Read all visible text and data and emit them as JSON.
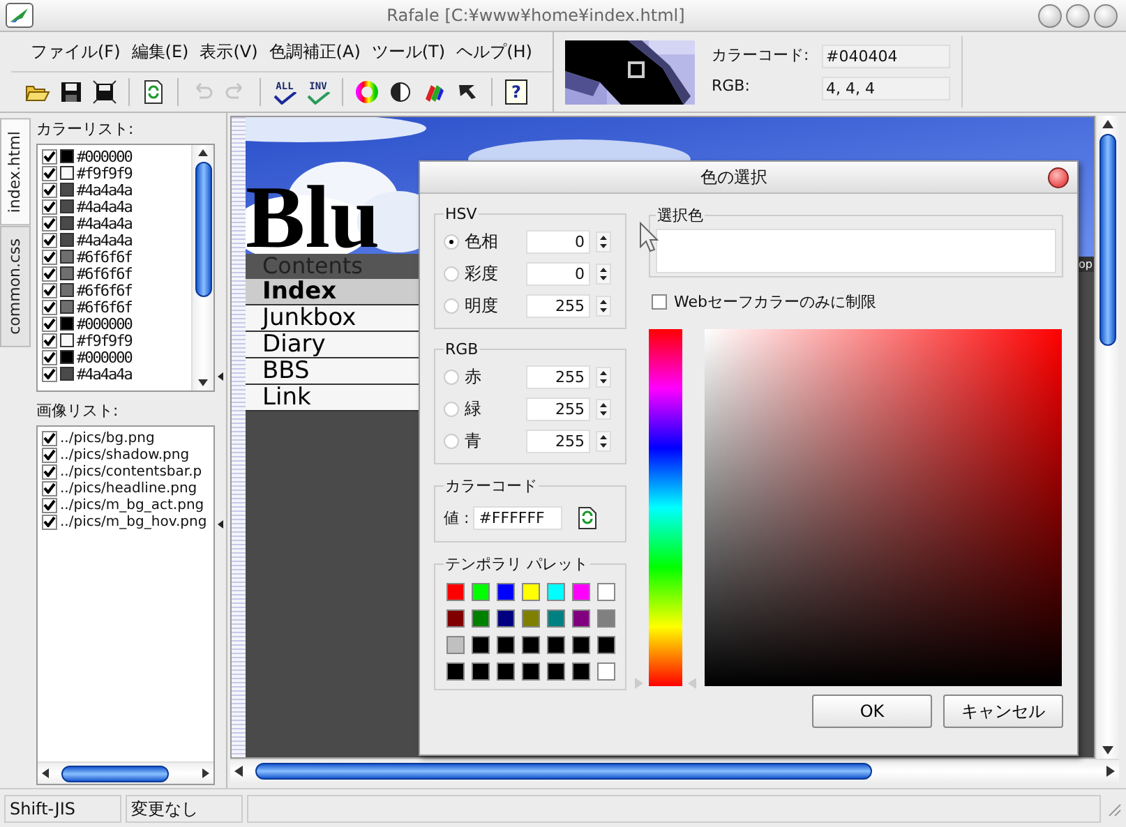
{
  "window": {
    "title": "Rafale [C:¥www¥home¥index.html]"
  },
  "menu": [
    "ファイル(F)",
    "編集(E)",
    "表示(V)",
    "色調補正(A)",
    "ツール(T)",
    "ヘルプ(H)"
  ],
  "toolbar": [
    [
      {
        "kind": "open",
        "disabled": false
      },
      {
        "kind": "save",
        "disabled": false
      },
      {
        "kind": "save-all",
        "disabled": false
      }
    ],
    [
      {
        "kind": "reload",
        "disabled": false
      }
    ],
    [
      {
        "kind": "undo",
        "disabled": true
      },
      {
        "kind": "redo",
        "disabled": true
      }
    ],
    [
      {
        "kind": "check-all",
        "disabled": false,
        "caption": "ALL"
      },
      {
        "kind": "check-invert",
        "disabled": false,
        "caption": "INV"
      }
    ],
    [
      {
        "kind": "color-wheel",
        "disabled": false
      },
      {
        "kind": "contrast",
        "disabled": false
      },
      {
        "kind": "rgb",
        "disabled": false
      },
      {
        "kind": "pointer",
        "disabled": false
      }
    ],
    [
      {
        "kind": "help",
        "disabled": false,
        "caption": "?"
      }
    ]
  ],
  "pixel_info": {
    "code_label": "カラーコード:",
    "code": "#040404",
    "rgb_label": "RGB:",
    "rgb": "4, 4, 4"
  },
  "file_tabs": [
    {
      "label": "index.html",
      "selected": true
    },
    {
      "label": "common.css",
      "selected": false
    }
  ],
  "color_list": {
    "title": "カラーリスト:",
    "items": [
      {
        "checked": true,
        "color": "#000000",
        "code": "#000000"
      },
      {
        "checked": true,
        "color": "#f9f9f9",
        "code": "#f9f9f9"
      },
      {
        "checked": true,
        "color": "#4a4a4a",
        "code": "#4a4a4a"
      },
      {
        "checked": true,
        "color": "#4a4a4a",
        "code": "#4a4a4a"
      },
      {
        "checked": true,
        "color": "#4a4a4a",
        "code": "#4a4a4a"
      },
      {
        "checked": true,
        "color": "#4a4a4a",
        "code": "#4a4a4a"
      },
      {
        "checked": true,
        "color": "#6f6f6f",
        "code": "#6f6f6f"
      },
      {
        "checked": true,
        "color": "#6f6f6f",
        "code": "#6f6f6f"
      },
      {
        "checked": true,
        "color": "#6f6f6f",
        "code": "#6f6f6f"
      },
      {
        "checked": true,
        "color": "#6f6f6f",
        "code": "#6f6f6f"
      },
      {
        "checked": true,
        "color": "#000000",
        "code": "#000000"
      },
      {
        "checked": true,
        "color": "#f9f9f9",
        "code": "#f9f9f9"
      },
      {
        "checked": true,
        "color": "#000000",
        "code": "#000000"
      },
      {
        "checked": true,
        "color": "#4a4a4a",
        "code": "#4a4a4a"
      }
    ]
  },
  "image_list": {
    "title": "画像リスト:",
    "items": [
      {
        "checked": true,
        "path": "../pics/bg.png"
      },
      {
        "checked": true,
        "path": "../pics/shadow.png"
      },
      {
        "checked": true,
        "path": "../pics/contentsbar.p"
      },
      {
        "checked": true,
        "path": "../pics/headline.png"
      },
      {
        "checked": true,
        "path": "../pics/m_bg_act.png"
      },
      {
        "checked": true,
        "path": "../pics/m_bg_hov.png"
      }
    ]
  },
  "preview": {
    "heading": "Blu",
    "menu_title": "Contents",
    "menu": [
      {
        "label": "Index",
        "selected": true
      },
      {
        "label": "Junkbox",
        "selected": false
      },
      {
        "label": "Diary",
        "selected": false
      },
      {
        "label": "BBS",
        "selected": false
      },
      {
        "label": "Link",
        "selected": false
      }
    ],
    "tag": "op"
  },
  "dialog": {
    "title": "色の選択",
    "hsv": {
      "title": "HSV",
      "rows": [
        {
          "label": "色相",
          "value": "0",
          "selected": true
        },
        {
          "label": "彩度",
          "value": "0",
          "selected": false
        },
        {
          "label": "明度",
          "value": "255",
          "selected": false
        }
      ]
    },
    "rgb": {
      "title": "RGB",
      "rows": [
        {
          "label": "赤",
          "value": "255",
          "selected": false
        },
        {
          "label": "緑",
          "value": "255",
          "selected": false
        },
        {
          "label": "青",
          "value": "255",
          "selected": false
        }
      ]
    },
    "code": {
      "title": "カラーコード",
      "label": "値 :",
      "value": "#FFFFFF"
    },
    "palette": {
      "title": "テンポラリ パレット",
      "swatches": [
        {
          "color": "#ff0000"
        },
        {
          "color": "#00ff00"
        },
        {
          "color": "#0000ff"
        },
        {
          "color": "#ffff00"
        },
        {
          "color": "#00ffff"
        },
        {
          "color": "#ff00ff"
        },
        {
          "color": "#ffffff"
        },
        {
          "color": "#800000"
        },
        {
          "color": "#008000"
        },
        {
          "color": "#000080"
        },
        {
          "color": "#808000"
        },
        {
          "color": "#008080"
        },
        {
          "color": "#800080"
        },
        {
          "color": "#808080"
        },
        {
          "color": "#c0c0c0"
        },
        {
          "color": "#000000"
        },
        {
          "color": "#000000"
        },
        {
          "color": "#000000"
        },
        {
          "color": "#000000"
        },
        {
          "color": "#000000"
        },
        {
          "color": "#000000"
        },
        {
          "color": "#000000"
        },
        {
          "color": "#000000"
        },
        {
          "color": "#000000"
        },
        {
          "color": "#000000"
        },
        {
          "color": "#000000"
        },
        {
          "color": "#000000"
        },
        {
          "color": "#ffffff"
        }
      ]
    },
    "hue": {
      "level": 0
    },
    "selected_color": {
      "title": "選択色",
      "color": "#ffffff"
    },
    "web_safe": {
      "label": "Webセーフカラーのみに制限",
      "checked": false
    },
    "buttons": [
      "OK",
      "キャンセル"
    ]
  },
  "status_bar": [
    "Shift-JIS",
    "変更なし"
  ]
}
